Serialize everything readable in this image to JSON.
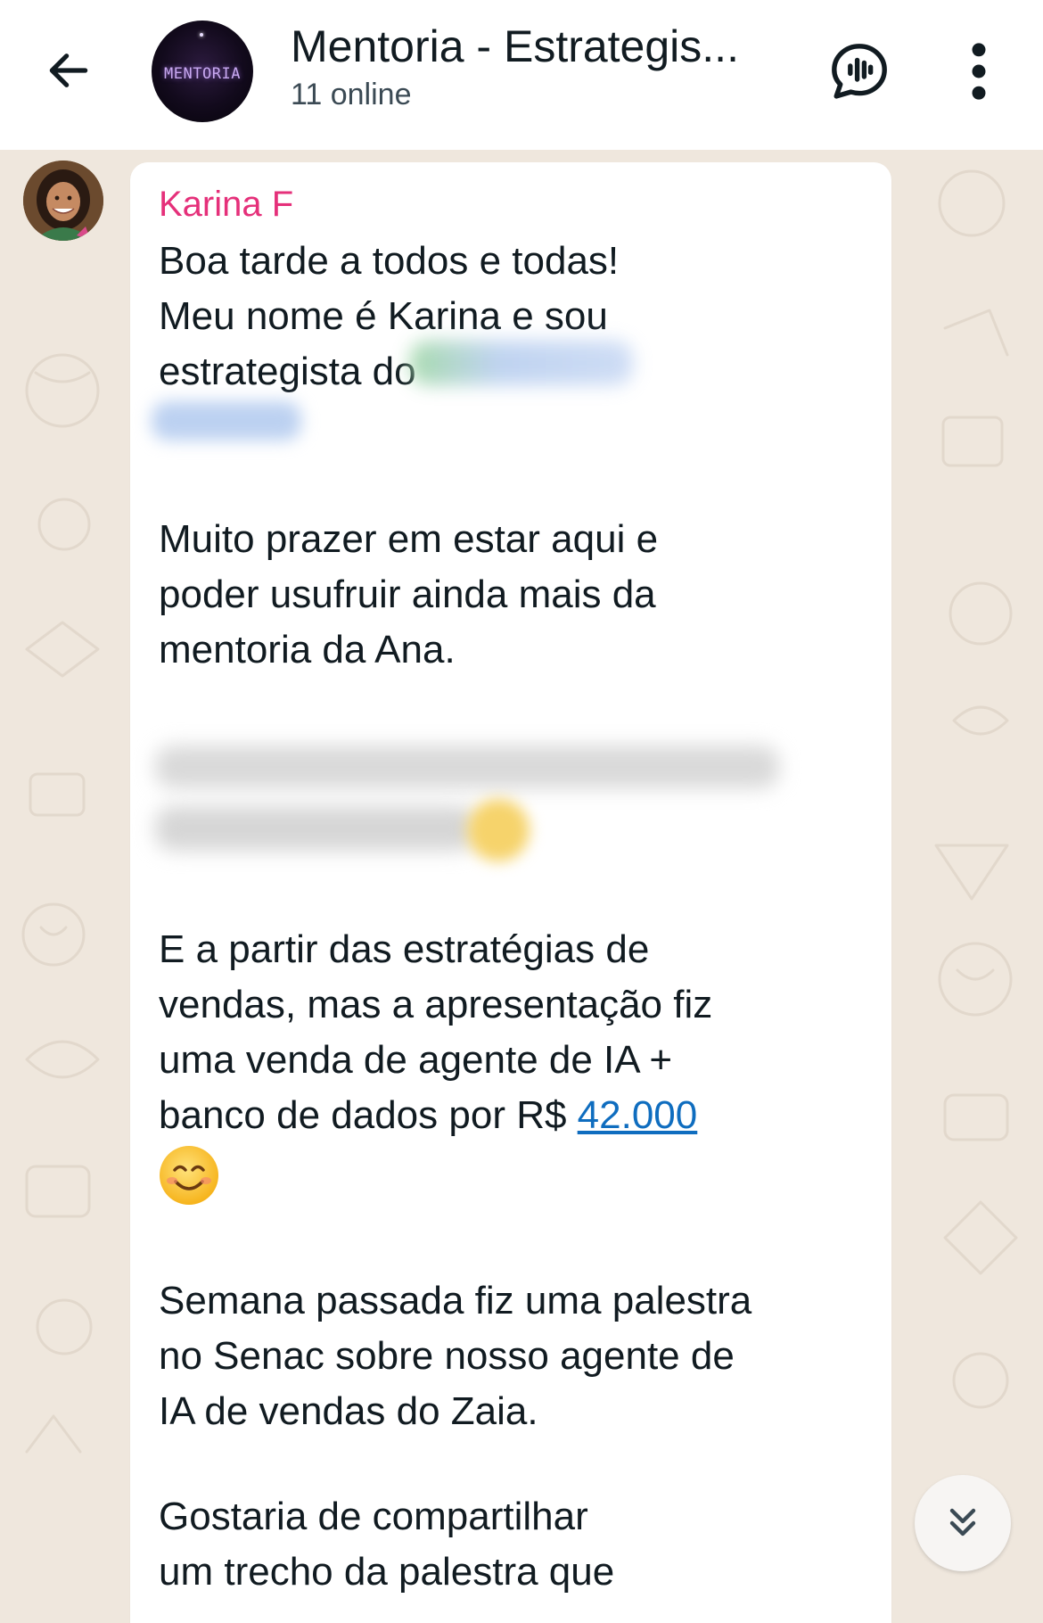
{
  "header": {
    "back_icon": "arrow-left-icon",
    "group_avatar_text": "MENTORIA",
    "title": "Mentoria - Estrategis...",
    "subtitle": "11 online",
    "voice_icon": "voice-chat-icon",
    "menu_icon": "more-vertical-icon"
  },
  "message": {
    "sender": "Karina F",
    "sender_color": "#e5307a",
    "paragraph_1": "Boa tarde a todos e todas!\nMeu nome é Karina e sou\nestrategista do",
    "paragraph_2": "Muito prazer em estar aqui e\npoder usufruir ainda mais da\nmentoria da Ana.",
    "paragraph_3_before_link": "E a partir das estratégias de\nvendas, mas a apresentação fiz\numa venda de agente de IA +\nbanco de dados por R$ ",
    "paragraph_3_link": "42.000",
    "paragraph_3_emoji": "smiling-face-icon",
    "paragraph_4": "Semana passada fiz uma palestra\nno Senac sobre nosso agente de\nIA de vendas do Zaia.",
    "paragraph_5": "Gostaria de compartilhar\num trecho da palestra que"
  },
  "controls": {
    "scroll_down_icon": "double-chevron-down-icon"
  },
  "colors": {
    "header_bg": "#ffffff",
    "chat_bg": "#efe7dd",
    "bubble_bg": "#ffffff",
    "link": "#0f6dbf",
    "text": "#111b21"
  }
}
